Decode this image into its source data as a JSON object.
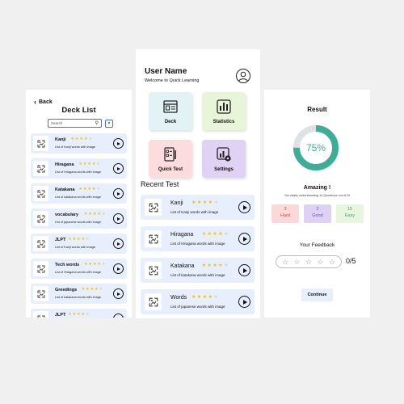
{
  "deck_screen": {
    "back_label": "Back",
    "title": "Deck List",
    "search_placeholder": "Search",
    "decks": [
      {
        "name": "Kanji",
        "description": "List of Kanji words with image",
        "rating": 4
      },
      {
        "name": "Hiragana",
        "description": "List of Hiragana words with image",
        "rating": 4
      },
      {
        "name": "Katakana",
        "description": "List of katakana words with image",
        "rating": 4
      },
      {
        "name": "vocabulary",
        "description": "List of japanese words with image",
        "rating": 4
      },
      {
        "name": "JLPT",
        "description": "List of Kanji words with image",
        "rating": 4
      },
      {
        "name": "Tech words",
        "description": "List of Hiragana words with image",
        "rating": 4
      },
      {
        "name": "Greedings",
        "description": "List of katakana words with image",
        "rating": 4
      },
      {
        "name": "JLPT",
        "description": "List of Kanji words with image",
        "rating": 4
      }
    ]
  },
  "home_screen": {
    "user_name": "User Name",
    "welcome": "Welcome to Quick Learning",
    "tiles": [
      {
        "label": "Deck",
        "color": "#e3f2f4",
        "icon": "book-icon"
      },
      {
        "label": "Statistics",
        "color": "#e9f5d8",
        "icon": "bar-chart-icon"
      },
      {
        "label": "Quick Test",
        "color": "#fcdcdc",
        "icon": "checklist-icon"
      },
      {
        "label": "Settings",
        "color": "#dfd2f5",
        "icon": "settings-icon"
      }
    ],
    "recent_title": "Recent Test",
    "recent": [
      {
        "name": "Kanji",
        "description": "List of Kanji words with image",
        "rating": 4
      },
      {
        "name": "Hiragana",
        "description": "List of Hiragana words with image",
        "rating": 4
      },
      {
        "name": "Katakana",
        "description": "List of katakana words with image",
        "rating": 4
      },
      {
        "name": "Words",
        "description": "List of japanese words with image",
        "rating": 4
      }
    ]
  },
  "result_screen": {
    "title": "Result",
    "percent": 75,
    "percent_label": "75%",
    "amazing": "Amazing !",
    "understanding": "You easily understanding 14 Questions out of 20",
    "buttons": [
      {
        "count": "3",
        "label": "Hard",
        "bg": "#fcd8d8",
        "fg": "#d44c4c"
      },
      {
        "count": "2",
        "label": "Good",
        "bg": "#ddd1f5",
        "fg": "#6b4fc4"
      },
      {
        "count": "15",
        "label": "Easy",
        "bg": "#e7f6df",
        "fg": "#3aa66d"
      }
    ],
    "feedback_title": "Your Feedback",
    "feedback_count": "0/5",
    "continue_label": "Continue"
  },
  "colors": {
    "accent_teal": "#3cae95",
    "list_bg": "#e8effc",
    "star_on": "#f2c200",
    "star_off": "#cfd3dc"
  }
}
